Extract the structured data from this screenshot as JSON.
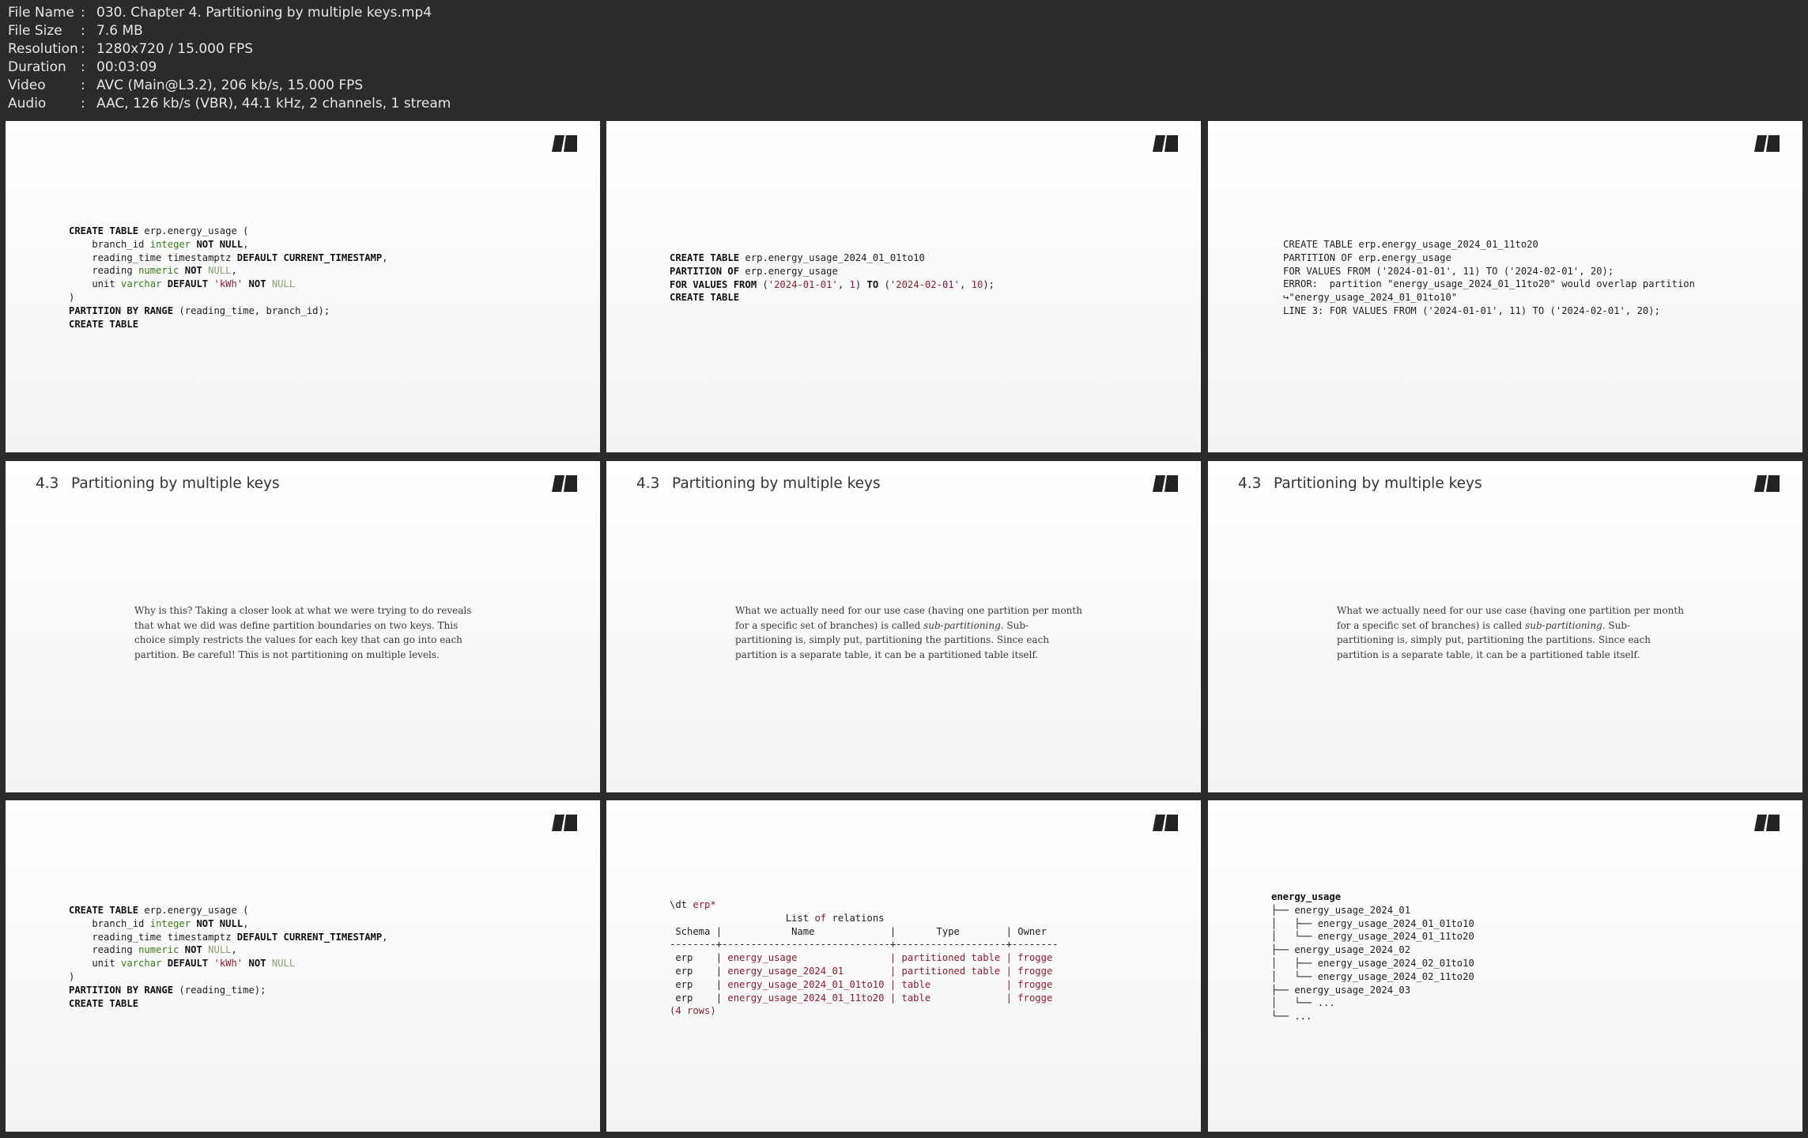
{
  "info": {
    "rows": [
      {
        "key": "File Name",
        "value": "030. Chapter 4. Partitioning by multiple keys.mp4"
      },
      {
        "key": "File Size",
        "value": "7.6 MB"
      },
      {
        "key": "Resolution",
        "value": "1280x720 / 15.000 FPS"
      },
      {
        "key": "Duration",
        "value": "00:03:09"
      },
      {
        "key": "Video",
        "value": "AVC (Main@L3.2), 206 kb/s, 15.000 FPS"
      },
      {
        "key": "Audio",
        "value": "AAC, 126 kb/s (VBR), 44.1 kHz, 2 channels, 1 stream"
      }
    ]
  },
  "slides": {
    "s1": {
      "l1": [
        "CREATE TABLE",
        " erp.energy_usage ("
      ],
      "l2": [
        "    branch_id ",
        "integer",
        " ",
        "NOT NULL",
        ","
      ],
      "l3": [
        "    reading_time timestamptz ",
        "DEFAULT CURRENT_TIMESTAMP",
        ","
      ],
      "l4": [
        "    reading ",
        "numeric",
        " ",
        "NOT",
        " ",
        "NULL",
        ","
      ],
      "l5": [
        "    unit ",
        "varchar",
        " ",
        "DEFAULT",
        " ",
        "'kWh'",
        " ",
        "NOT",
        " ",
        "NULL"
      ],
      "l6": ")",
      "l7": [
        "PARTITION BY RANGE",
        " (reading_time, branch_id);"
      ],
      "l8": "CREATE TABLE"
    },
    "s2": {
      "l1": [
        "CREATE TABLE",
        " erp.energy_usage_2024_01_01to10"
      ],
      "l2": [
        "PARTITION OF",
        " erp.energy_usage"
      ],
      "l3": [
        "FOR VALUES FROM",
        " (",
        "'2024-01-01'",
        ", ",
        "1",
        ") ",
        "TO",
        " (",
        "'2024-02-01'",
        ", ",
        "10",
        ");"
      ],
      "l4": "CREATE TABLE"
    },
    "s3": {
      "lines": [
        "CREATE TABLE erp.energy_usage_2024_01_11to20",
        "PARTITION OF erp.energy_usage",
        "FOR VALUES FROM ('2024-01-01', 11) TO ('2024-02-01', 20);",
        "ERROR:  partition \"energy_usage_2024_01_11to20\" would overlap partition",
        "↪\"energy_usage_2024_01_01to10\"",
        "LINE 3: FOR VALUES FROM ('2024-01-01', 11) TO ('2024-02-01', 20);"
      ]
    },
    "section_num": "4.3",
    "section_title": "Partitioning by multiple keys",
    "s4": {
      "text": "Why is this? Taking a closer look at what we were trying to do reveals that what we did was define partition boundaries on two keys. This choice simply restricts the values for each key that can go into each partition. Be careful! This is not partitioning on multiple levels."
    },
    "s5": {
      "pre": "What we actually need for our use case (having one partition per month for a specific set of branches) is called ",
      "em": "sub-partitioning",
      "post": ". Sub-partitioning is, simply put, partitioning the partitions. Since each partition is a separate table, it can be a partitioned table itself."
    },
    "s7": {
      "l1": [
        "CREATE TABLE",
        " erp.energy_usage ("
      ],
      "l2": [
        "    branch_id ",
        "integer",
        " ",
        "NOT NULL",
        ","
      ],
      "l3": [
        "    reading_time timestamptz ",
        "DEFAULT CURRENT_TIMESTAMP",
        ","
      ],
      "l4": [
        "    reading ",
        "numeric",
        " ",
        "NOT",
        " ",
        "NULL",
        ","
      ],
      "l5": [
        "    unit ",
        "varchar",
        " ",
        "DEFAULT",
        " ",
        "'kWh'",
        " ",
        "NOT",
        " ",
        "NULL"
      ],
      "l6": ")",
      "l7": [
        "PARTITION BY RANGE",
        " (reading_time);"
      ],
      "l8": "CREATE TABLE"
    },
    "s8": {
      "cmd": [
        "\\dt ",
        "erp*"
      ],
      "title": [
        "                    List ",
        "of",
        " relations"
      ],
      "header": " Schema |            Name             |       Type        | Owner",
      "sep": "--------+-----------------------------+-------------------+--------",
      "rows": [
        {
          "schema": " erp    | ",
          "name": "energy_usage               ",
          "type": " | partitioned table | ",
          "owner": "frogge"
        },
        {
          "schema": " erp    | ",
          "name": "energy_usage_2024_01       ",
          "type": " | partitioned table | ",
          "owner": "frogge"
        },
        {
          "schema": " erp    | ",
          "name": "energy_usage_2024_01_01to10",
          "type": " | table             | ",
          "owner": "frogge"
        },
        {
          "schema": " erp    | ",
          "name": "energy_usage_2024_01_11to20",
          "type": " | table             | ",
          "owner": "frogge"
        }
      ],
      "footer": "(4 rows)"
    },
    "s9": {
      "root": "energy_usage",
      "lines": [
        "├── energy_usage_2024_01",
        "│   ├── energy_usage_2024_01_01to10",
        "│   └── energy_usage_2024_01_11to20",
        "├── energy_usage_2024_02",
        "│   ├── energy_usage_2024_02_01to10",
        "│   └── energy_usage_2024_02_11to20",
        "├── energy_usage_2024_03",
        "│   └── ...",
        "└── ..."
      ]
    }
  }
}
